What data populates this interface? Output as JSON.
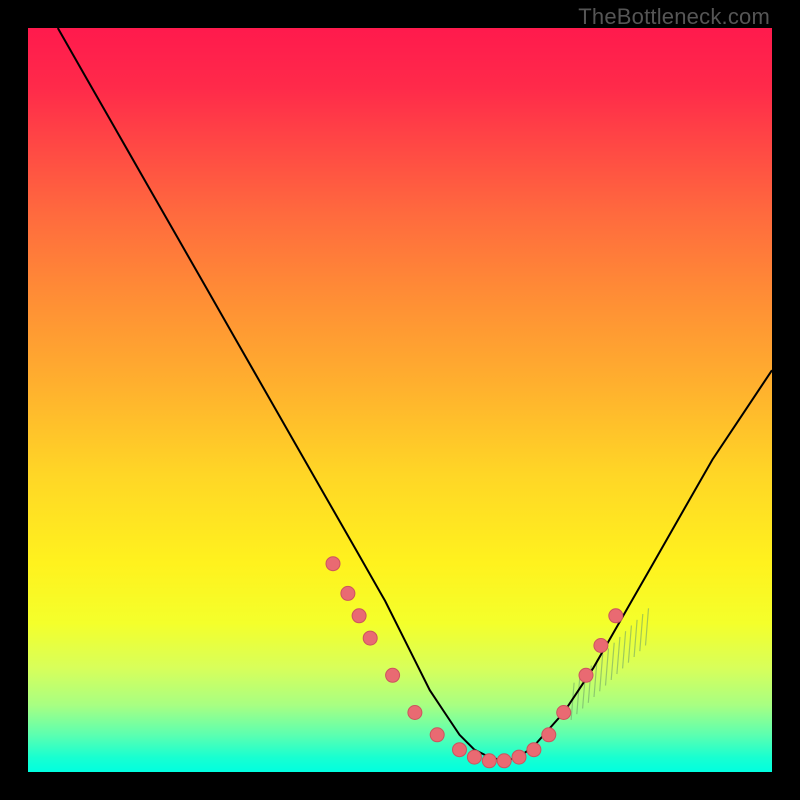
{
  "watermark": "TheBottleneck.com",
  "chart_data": {
    "type": "line",
    "title": "",
    "xlabel": "",
    "ylabel": "",
    "xlim": [
      0,
      100
    ],
    "ylim": [
      0,
      100
    ],
    "curve": {
      "x": [
        4,
        8,
        12,
        16,
        20,
        24,
        28,
        32,
        36,
        40,
        44,
        48,
        52,
        54,
        56,
        58,
        60,
        62,
        64,
        66,
        68,
        72,
        76,
        80,
        84,
        88,
        92,
        96,
        100
      ],
      "y": [
        100,
        93,
        86,
        79,
        72,
        65,
        58,
        51,
        44,
        37,
        30,
        23,
        15,
        11,
        8,
        5,
        3,
        2,
        1.5,
        2,
        3.5,
        8,
        14,
        21,
        28,
        35,
        42,
        48,
        54
      ]
    },
    "dots": {
      "x": [
        41,
        43,
        44.5,
        46,
        49,
        52,
        55,
        58,
        60,
        62,
        64,
        66,
        68,
        70,
        72,
        75,
        77,
        79
      ],
      "y": [
        28,
        24,
        21,
        18,
        13,
        8,
        5,
        3,
        2,
        1.5,
        1.5,
        2,
        3,
        5,
        8,
        13,
        17,
        21
      ]
    },
    "hatches": {
      "x_start": 73,
      "x_end": 83,
      "count": 14,
      "y_base_range": [
        7,
        17
      ],
      "height": 5
    },
    "colors": {
      "gradient_top": "#ff1a4d",
      "gradient_mid": "#ffd626",
      "gradient_bottom": "#00ffe0",
      "curve": "#000000",
      "dots": "#e96a72",
      "hatches": "#6aa06a"
    }
  }
}
